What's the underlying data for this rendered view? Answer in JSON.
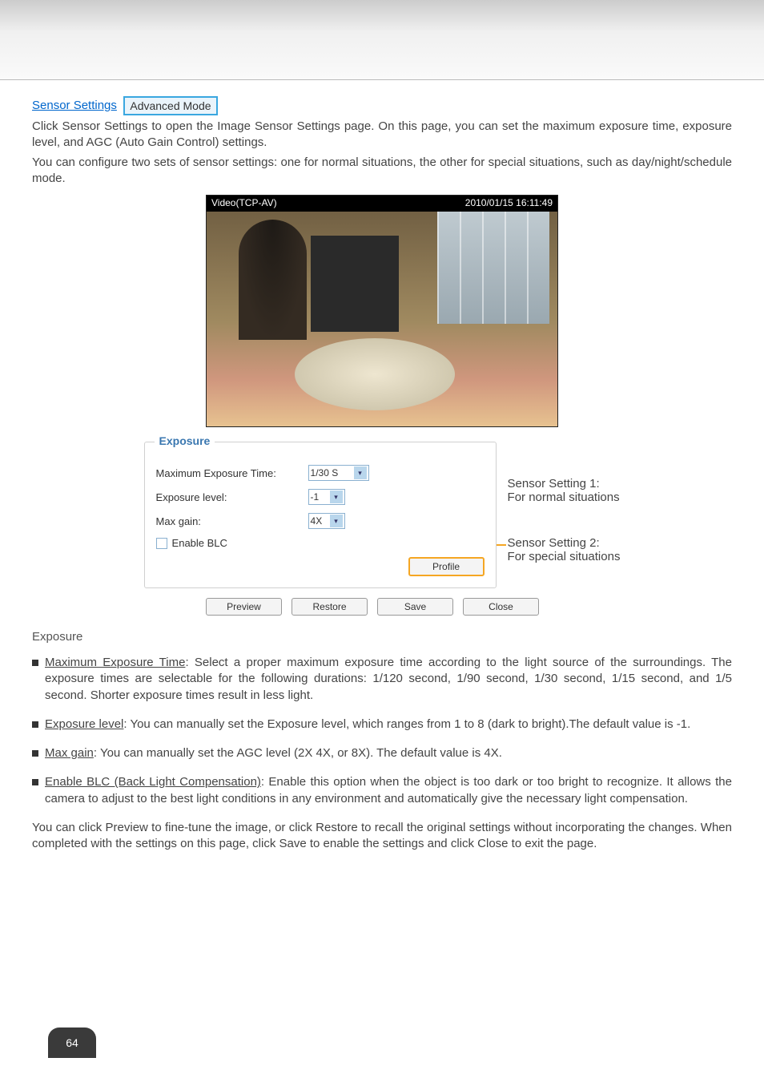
{
  "section_link": "Sensor Settings",
  "badge": "Advanced Mode",
  "intro_p1": "Click Sensor Settings to open the Image Sensor Settings page. On this page, you can set the maximum exposure time, exposure level, and AGC (Auto Gain Control) settings.",
  "intro_p2": "You can configure two sets of sensor settings: one for normal situations, the other for special situations, such as day/night/schedule mode.",
  "video": {
    "title": "Video(TCP-AV)",
    "timestamp": "2010/01/15 16:11:49"
  },
  "exposure": {
    "legend": "Exposure",
    "max_exposure_label": "Maximum Exposure Time:",
    "max_exposure_value": "1/30 S",
    "level_label": "Exposure level:",
    "level_value": "-1",
    "max_gain_label": "Max gain:",
    "max_gain_value": "4X",
    "blc_label": "Enable BLC",
    "profile_btn": "Profile",
    "preview_btn": "Preview",
    "restore_btn": "Restore",
    "save_btn": "Save",
    "close_btn": "Close"
  },
  "anno1_a": "Sensor Setting 1:",
  "anno1_b": "For normal situations",
  "anno2_a": "Sensor Setting 2:",
  "anno2_b": "For special situations",
  "exposure_heading": "Exposure",
  "bullets": {
    "b1_u": "Maximum Exposure Time",
    "b1_t": ": Select a proper maximum exposure time according to the light source of the surroundings. The exposure times are selectable for the following durations: 1/120 second, 1/90 second, 1/30 second, 1/15 second, and 1/5 second. Shorter exposure times result in less light.",
    "b2_u": "Exposure level",
    "b2_t": ": You can manually set the Exposure level, which ranges from 1 to 8 (dark to bright).The default value is -1.",
    "b3_u": "Max gain",
    "b3_t": ": You can manually set the AGC level (2X 4X, or 8X). The default value is 4X.",
    "b4_u": "Enable BLC (Back Light Compensation)",
    "b4_t": ": Enable this option when the object is too dark or too bright to recognize. It allows the camera to adjust to the best light conditions in any environment and automatically give the necessary light compensation."
  },
  "closing": "You can click Preview to fine-tune the image, or click Restore to recall the original settings without incorporating the changes. When completed with the settings on this page, click Save to enable the settings and click Close to exit the page.",
  "page_number": "64"
}
